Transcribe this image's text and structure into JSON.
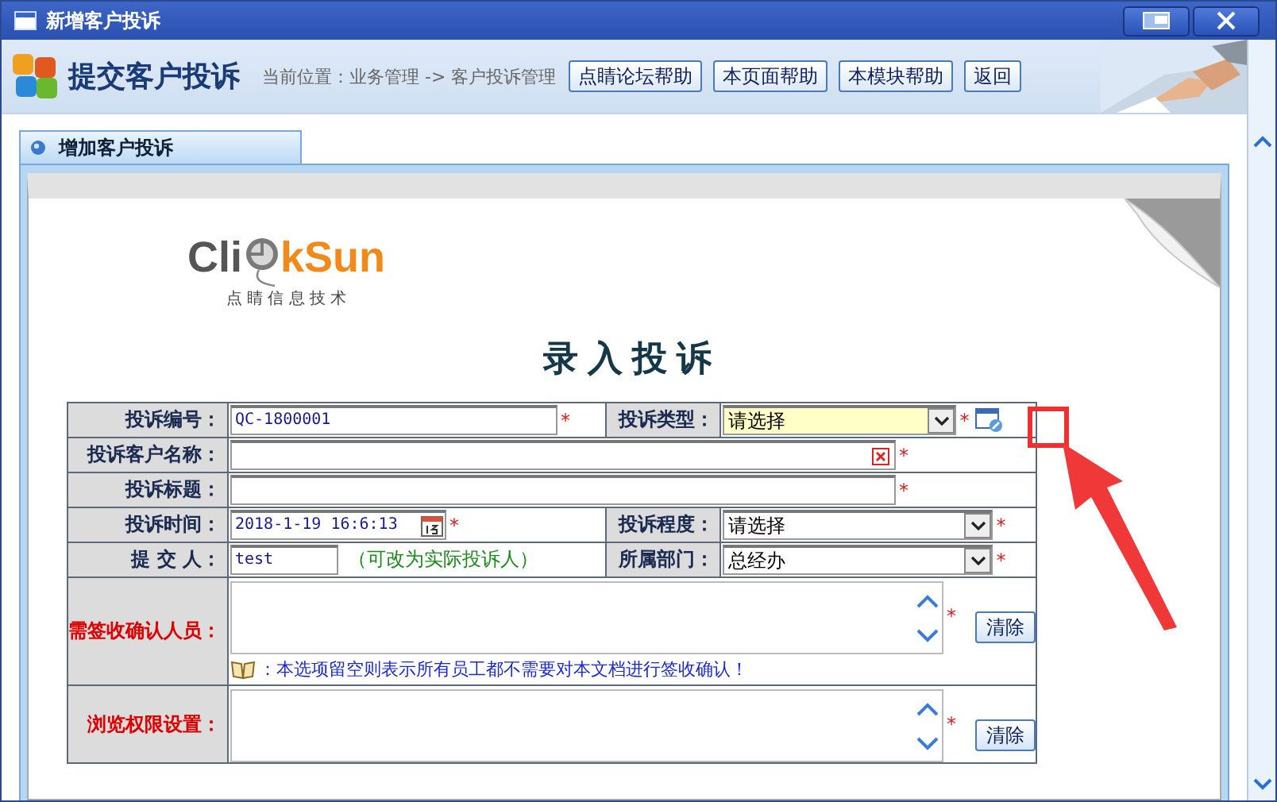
{
  "window": {
    "title": "新增客户投诉"
  },
  "header": {
    "title": "提交客户投诉",
    "breadcrumb": "当前位置：业务管理 -> 客户投诉管理",
    "buttons": [
      "点睛论坛帮助",
      "本页面帮助",
      "本模块帮助",
      "返回"
    ]
  },
  "panel": {
    "tab": "增加客户投诉"
  },
  "logo": {
    "left": "Cli",
    "right": "kSun",
    "tagline": "点 睛 信 息 技 术"
  },
  "form": {
    "title": "录入投诉",
    "rows": [
      {
        "fields": [
          {
            "label": "投诉编号：",
            "kind": "text",
            "value": "QC-1800001",
            "mark": "*"
          },
          {
            "label": "投诉类型：",
            "kind": "select",
            "value": "请选择",
            "highlighted": true,
            "mark": "*",
            "action_icon": true
          }
        ]
      },
      {
        "fields": [
          {
            "label": "投诉客户名称：",
            "kind": "clearable",
            "mark": "*"
          }
        ]
      },
      {
        "fields": [
          {
            "label": "投诉标题：",
            "kind": "text",
            "mark": "*"
          }
        ]
      },
      {
        "fields": [
          {
            "label": "投诉时间：",
            "kind": "date",
            "value": "2018-1-19 16:6:13",
            "mark": "*"
          },
          {
            "label": "投诉程度：",
            "kind": "select",
            "value": "请选择",
            "highlighted": false,
            "mark": "*"
          }
        ]
      },
      {
        "fields": [
          {
            "label": "提 交 人：",
            "kind": "short_text",
            "value": "test",
            "hint": "（可改为实际投诉人）"
          },
          {
            "label": "所属部门：",
            "kind": "select",
            "value": "总经办",
            "highlighted": false,
            "mark": "*"
          }
        ]
      },
      {
        "fields": [
          {
            "label": "需签收确认人员：",
            "kind": "picker",
            "mark": "*",
            "button": "清除",
            "note": "：本选项留空则表示所有员工都不需要对本文档进行签收确认！"
          }
        ]
      },
      {
        "fields": [
          {
            "label": "浏览权限设置：",
            "kind": "picker",
            "mark": "*",
            "button": "清除"
          }
        ]
      }
    ]
  }
}
